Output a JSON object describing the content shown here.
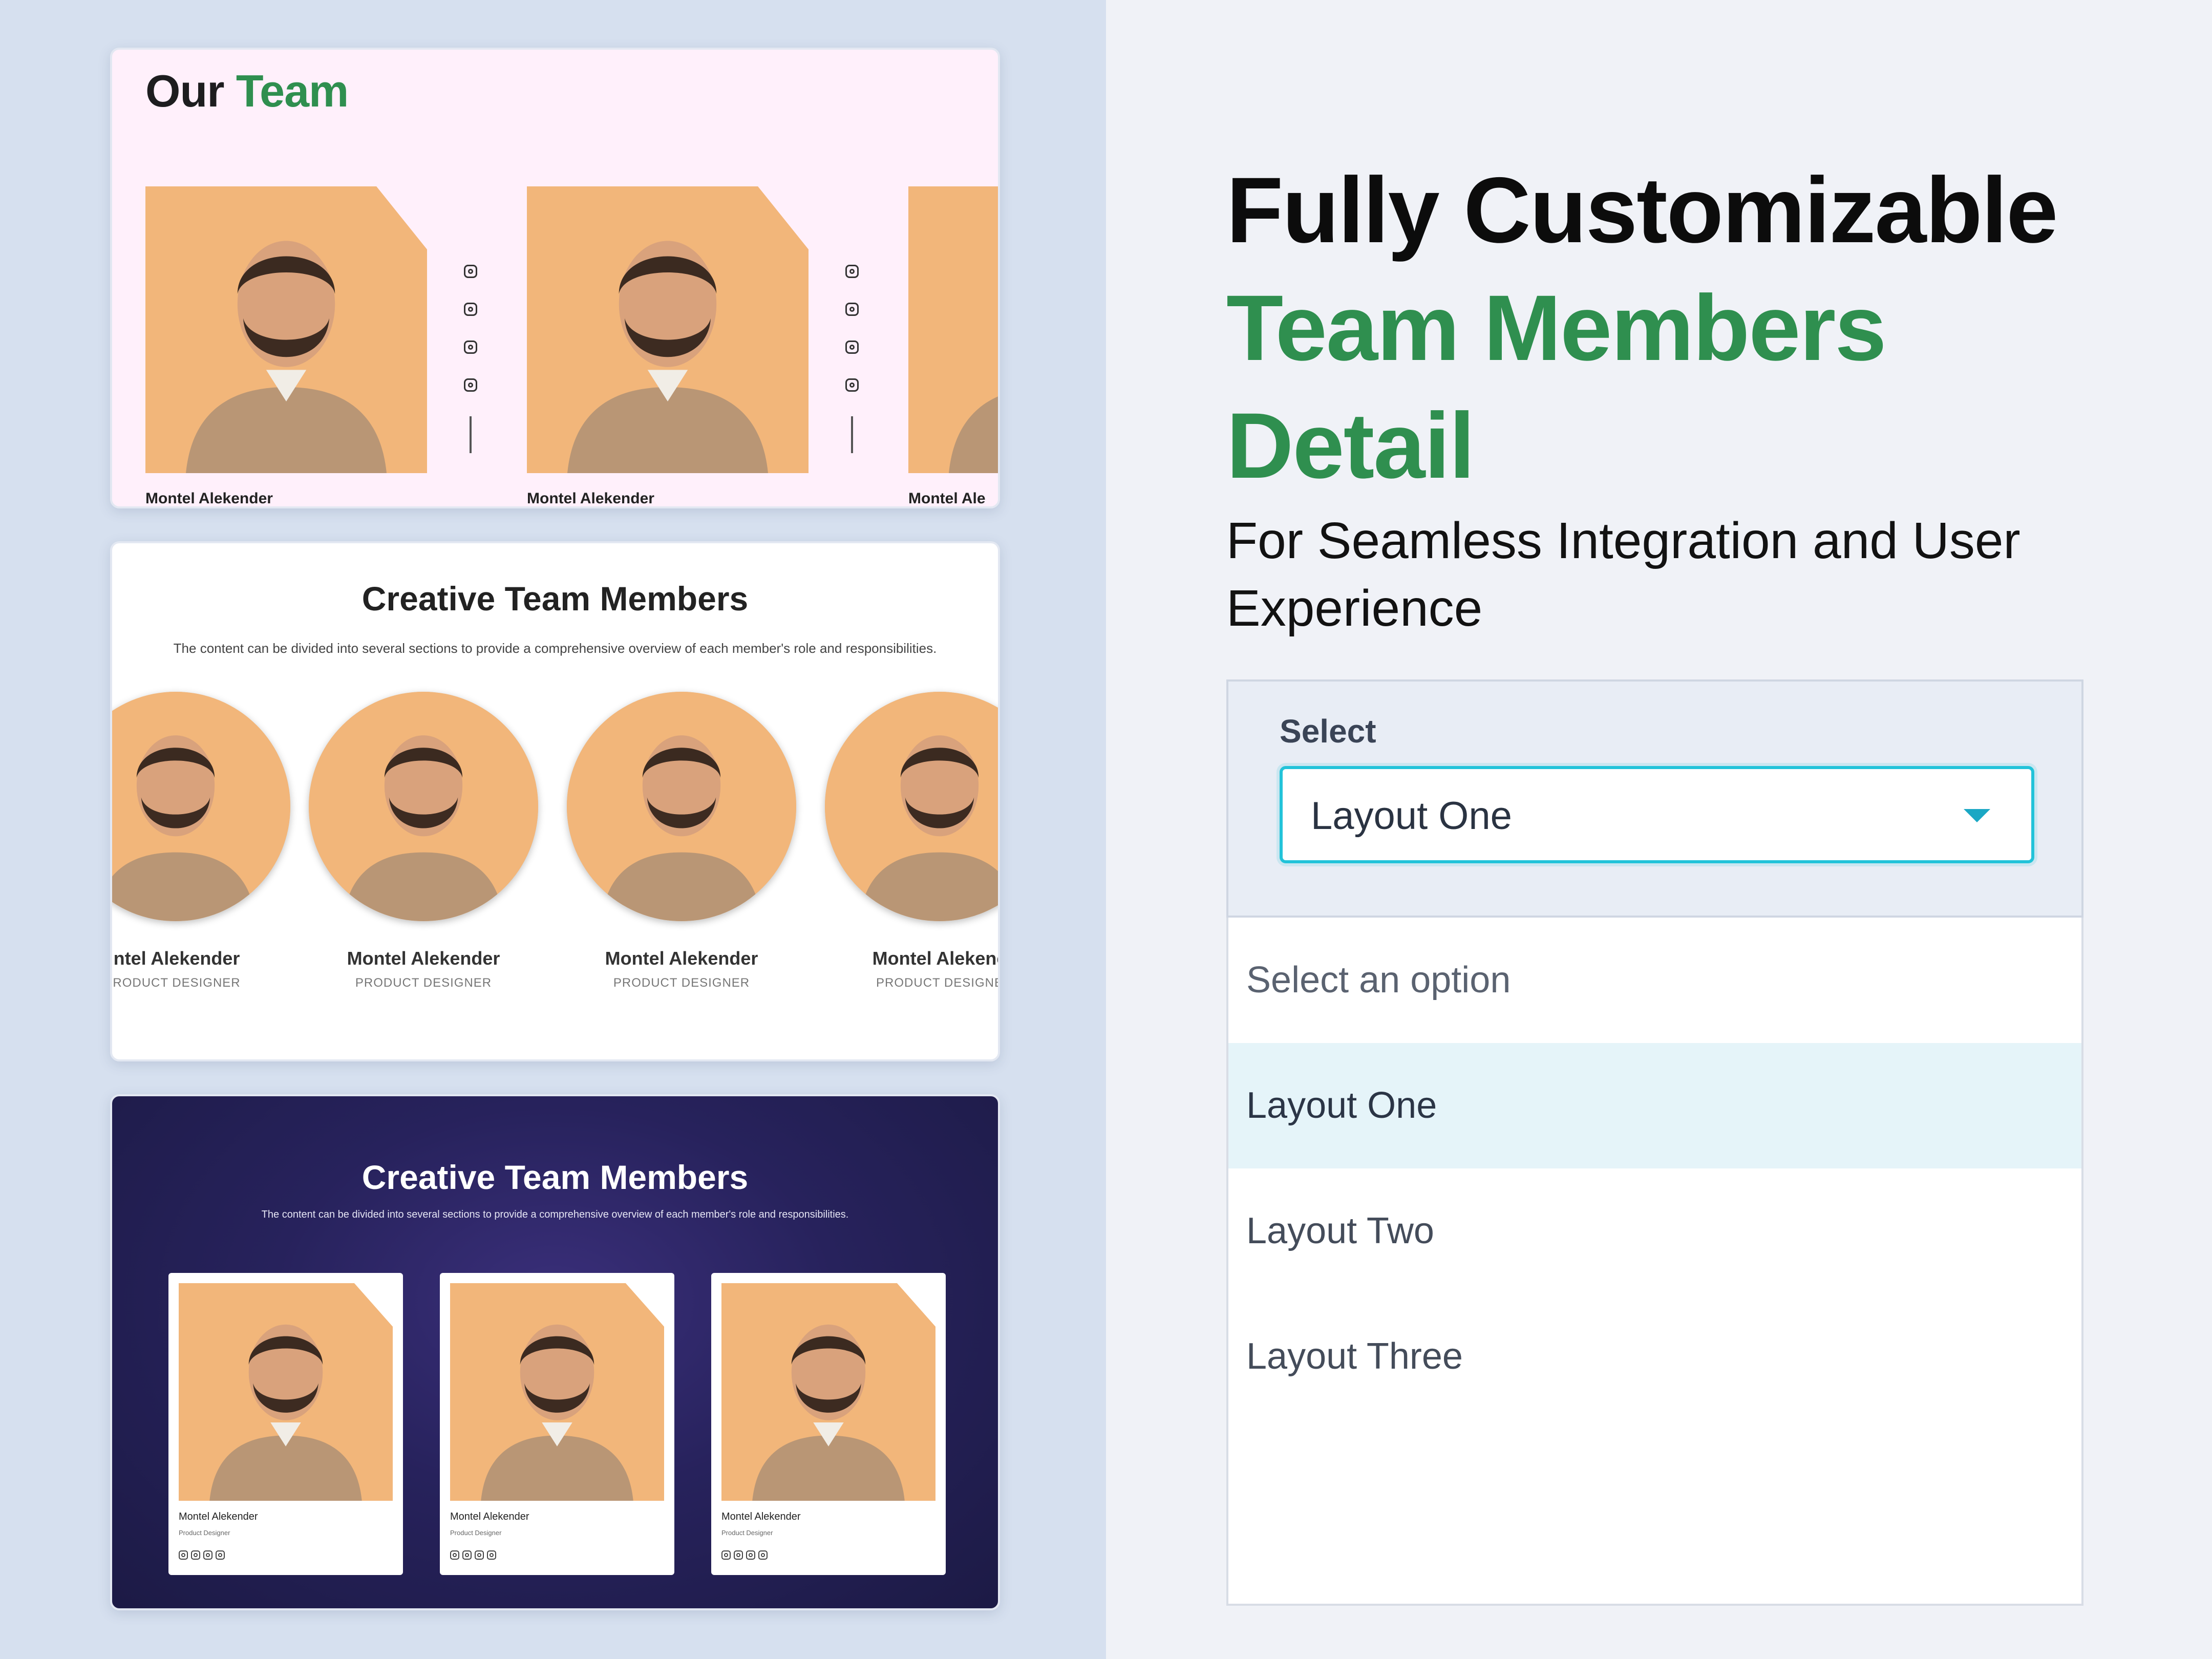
{
  "card1": {
    "title_plain": "Our",
    "title_accent": "Team",
    "members": [
      {
        "name": "Montel Alekender"
      },
      {
        "name": "Montel Alekender"
      },
      {
        "name": "Montel Ale"
      }
    ]
  },
  "card2": {
    "title": "Creative Team Members",
    "description": "The content can be divided into several sections to provide a comprehensive overview of each member's role and responsibilities.",
    "members": [
      {
        "name": "ntel Alekender",
        "role": "RODUCT DESIGNER"
      },
      {
        "name": "Montel Alekender",
        "role": "PRODUCT DESIGNER"
      },
      {
        "name": "Montel Alekender",
        "role": "PRODUCT DESIGNER"
      },
      {
        "name": "Montel Alekenc",
        "role": "PRODUCT DESIGNE"
      }
    ]
  },
  "card3": {
    "title": "Creative Team Members",
    "description": "The content can be divided into several sections to provide a comprehensive overview of each member's role and responsibilities.",
    "members": [
      {
        "name": "Montel Alekender",
        "role": "Product Designer"
      },
      {
        "name": "Montel Alekender",
        "role": "Product Designer"
      },
      {
        "name": "Montel Alekender",
        "role": "Product Designer"
      }
    ]
  },
  "headline": {
    "line1": "Fully Customizable",
    "line2": "Team Members",
    "line3": "Detail",
    "subtitle": "For Seamless Integration and User Experience"
  },
  "select": {
    "label": "Select",
    "value": "Layout One",
    "options": [
      "Select an option",
      "Layout One",
      "Layout Two",
      "Layout Three"
    ],
    "selected_index": 1
  },
  "colors": {
    "accent_green": "#2f8f4f",
    "focus_cyan": "#22c3d9",
    "option_highlight": "#e5f4f9"
  }
}
